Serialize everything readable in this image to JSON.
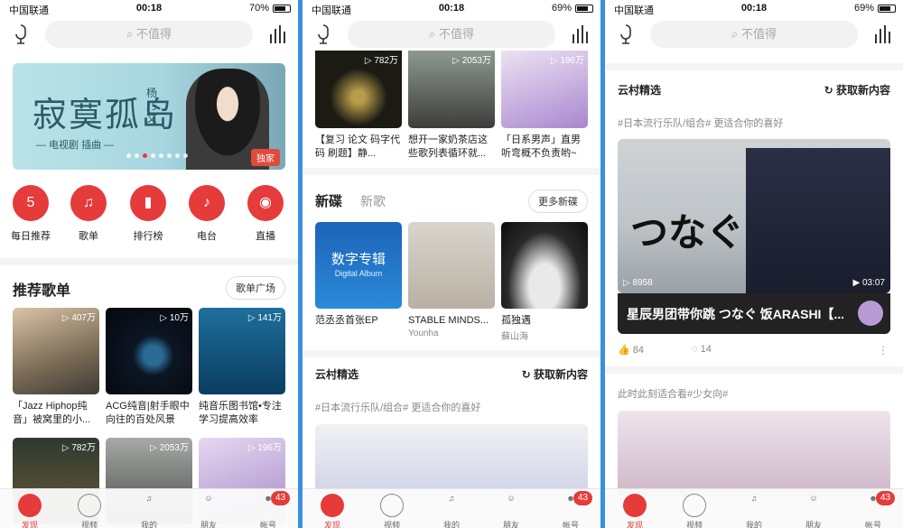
{
  "status": {
    "carrier": "中国联通",
    "time": "00:18",
    "battery": [
      "70%",
      "69%",
      "69%"
    ]
  },
  "search_placeholder": "不值得",
  "tabs": [
    "发现",
    "视频",
    "我的",
    "朋友",
    "帐号"
  ],
  "tab_badge": "43",
  "screen1": {
    "banner": {
      "title": "寂寞孤岛",
      "artist": "杨乃文",
      "caption": "— 电视剧",
      "caption2": "插曲 —",
      "tag": "独家"
    },
    "nav": [
      "每日推荐",
      "歌单",
      "排行榜",
      "电台",
      "直播"
    ],
    "nav_icons": [
      "calendar-icon",
      "playlist-icon",
      "chart-icon",
      "radio-icon",
      "live-icon"
    ],
    "day": "5",
    "section_title": "推荐歌单",
    "section_button": "歌单广场",
    "playlists": [
      {
        "count": "407万",
        "title": "「Jazz Hiphop纯音」被窝里的小..."
      },
      {
        "count": "10万",
        "title": "ACG纯音|射手眼中向往的百处风景"
      },
      {
        "count": "141万",
        "title": "纯音乐图书馆•专注学习提高效率"
      }
    ],
    "playlists_row2": [
      {
        "count": "782万"
      },
      {
        "count": "2053万"
      },
      {
        "count": "196万"
      }
    ]
  },
  "screen2": {
    "top_cards": [
      {
        "count": "782万",
        "title": "【复习 论文 码字代码 刷题】静..."
      },
      {
        "count": "2053万",
        "title": "想开一家奶茶店这些歌列表循环就..."
      },
      {
        "count": "196万",
        "title": "「日系男声」直男听弯概不负责哟~"
      }
    ],
    "tab_active": "新碟",
    "tab_inactive": "新歌",
    "more_button": "更多新碟",
    "albums": [
      {
        "title": "范丞丞首张EP",
        "artist": "",
        "art": "数字专辑",
        "art_sub": "Digital Album"
      },
      {
        "title": "STABLE MINDS...",
        "artist": "Younha"
      },
      {
        "title": "孤独遇",
        "artist": "蘇山海"
      }
    ],
    "feed_title": "云村精选",
    "refresh": "获取新内容",
    "hashtag": "#日本流行乐队/组合# 更适合你的喜好"
  },
  "screen3": {
    "feed_title": "云村精选",
    "refresh": "获取新内容",
    "hashtag": "#日本流行乐队/组合# 更适合你的喜好",
    "video": {
      "overlay": "つなぐ",
      "plays": "8958",
      "duration": "03:07",
      "title": "星辰男团带你跳 つなぐ 饭ARASHI【...",
      "likes": "84",
      "comments": "14"
    },
    "hashtag2": "此时此刻适合看#少女向#"
  },
  "colors": {
    "accent": "#e53b3b",
    "bg": "#3a8fe0"
  }
}
